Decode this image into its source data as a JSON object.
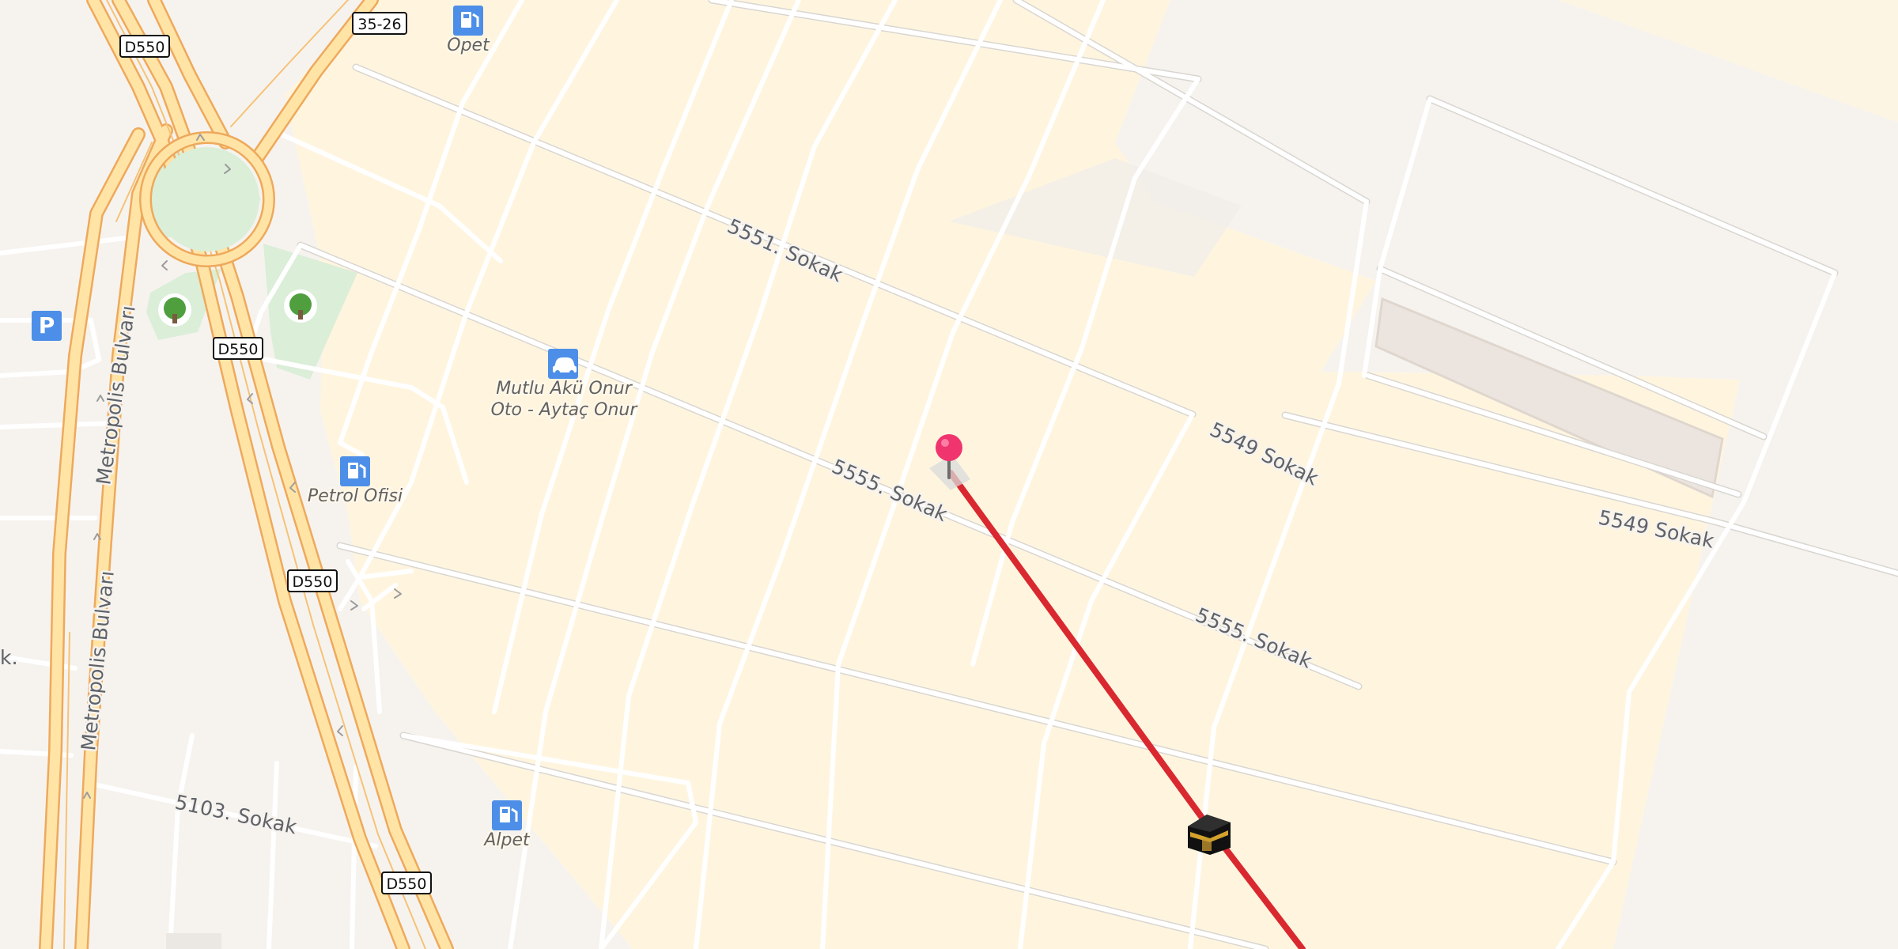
{
  "map": {
    "road_labels": {
      "sokak_5551": "5551. Sokak",
      "sokak_5555_a": "5555. Sokak",
      "sokak_5555_b": "5555. Sokak",
      "sokak_5549_a": "5549 Sokak",
      "sokak_5549_b": "5549 Sokak",
      "sokak_5103": "5103. Sokak",
      "metropolis_a": "Metropolis Bulvarı",
      "metropolis_b": "Metropolis Bulvarı",
      "truncated_left": "k."
    },
    "shields": {
      "d550_top": "D550",
      "d550_middle": "D550",
      "d550_low": "D550",
      "d550_bottom": "D550",
      "route_35_26": "35-26"
    },
    "pois": {
      "opet": "Opet",
      "mutlu_aku_line1": "Mutlu Akü Onur",
      "mutlu_aku_line2": "Oto - Aytaç Onur",
      "petrol_ofisi": "Petrol Ofisi",
      "alpet": "Alpet",
      "parking_letter": "P"
    },
    "icons": {
      "fuel_icon": "fuel-icon",
      "car_icon": "car-icon",
      "parking_icon": "parking-icon",
      "tree_icon": "tree-icon",
      "pin_icon": "pin-icon",
      "kaaba_icon": "kaaba-icon"
    },
    "colors": {
      "background": "#f6f3ef",
      "residential_area": "#fff5df",
      "minor_road": "#ffffff",
      "highway_outline": "#eea95c",
      "highway_fill": "#ffe4a6",
      "park": "#dbeed8",
      "poi_blue": "#4d8fe8",
      "route_line": "#d9282f",
      "pin_red": "#f0346e"
    }
  }
}
